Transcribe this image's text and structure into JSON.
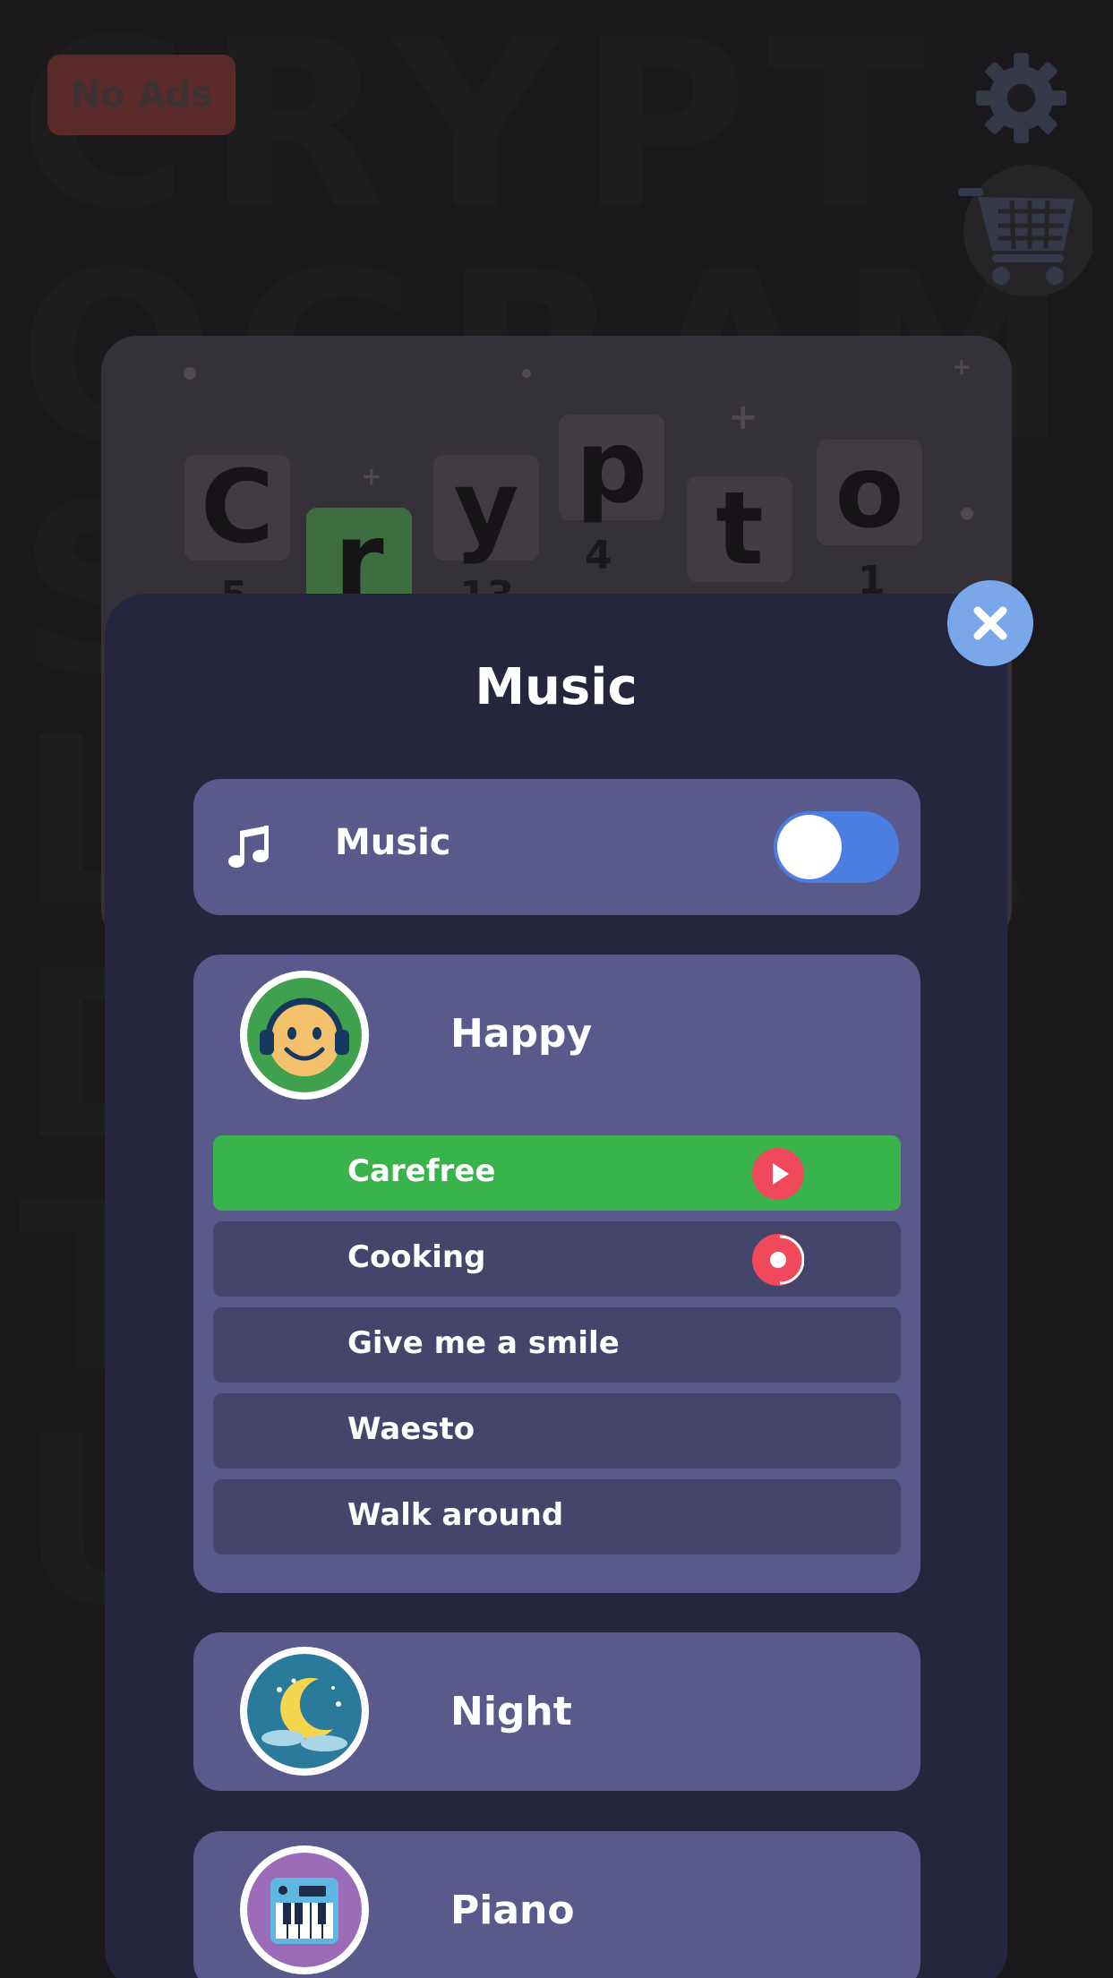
{
  "header": {
    "no_ads_label": "No Ads",
    "settings_icon": "gear-icon",
    "shop_icon": "shopping-cart-icon"
  },
  "logo": {
    "tiles": [
      {
        "letter": "C",
        "number": "5"
      },
      {
        "letter": "r",
        "number": ""
      },
      {
        "letter": "y",
        "number": "13"
      },
      {
        "letter": "p",
        "number": "4"
      },
      {
        "letter": "t",
        "number": ""
      },
      {
        "letter": "o",
        "number": "1"
      }
    ]
  },
  "modal": {
    "title": "Music",
    "close_icon": "close-icon",
    "music_toggle": {
      "icon": "music-note-icon",
      "label": "Music",
      "enabled": true
    },
    "groups": [
      {
        "name": "Happy",
        "icon": "smiley-headphones-icon",
        "expanded": true,
        "tracks": [
          {
            "name": "Carefree",
            "state": "playing"
          },
          {
            "name": "Cooking",
            "state": "loading"
          },
          {
            "name": "Give me a smile",
            "state": "none"
          },
          {
            "name": "Waesto",
            "state": "none"
          },
          {
            "name": "Walk around",
            "state": "none"
          }
        ]
      },
      {
        "name": "Night",
        "icon": "moon-night-icon",
        "expanded": false
      },
      {
        "name": "Piano",
        "icon": "piano-keyboard-icon",
        "expanded": false
      }
    ]
  },
  "colors": {
    "modal_bg": "#25253d",
    "card_bg": "#5a598c",
    "track_bg": "#45446b",
    "active_track": "#39b34b",
    "toggle_on": "#4b7ee0",
    "play_button": "#f0495c",
    "close_button": "#7aa7ea"
  }
}
